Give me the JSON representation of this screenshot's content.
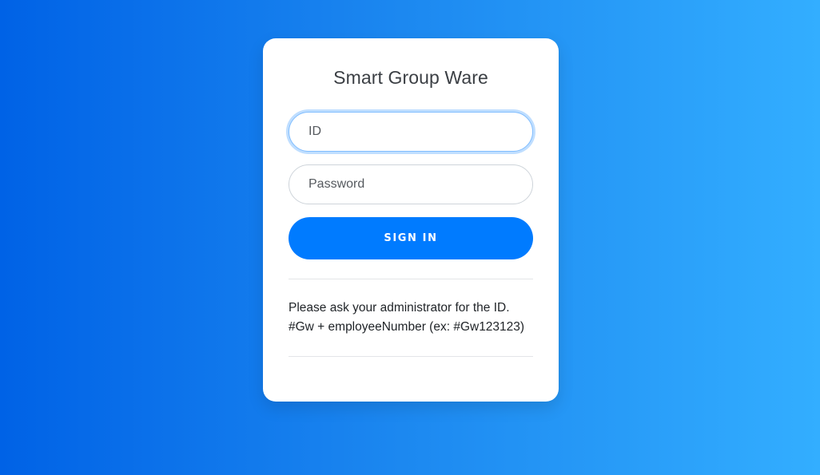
{
  "login": {
    "title": "Smart Group Ware",
    "id_field": {
      "placeholder": "ID",
      "value": ""
    },
    "password_field": {
      "placeholder": "Password",
      "value": ""
    },
    "signin_label": "SIGN IN",
    "help_lines": [
      "Please ask your administrator for the ID.",
      "#Gw + employeeNumber (ex: #Gw123123)"
    ]
  },
  "colors": {
    "background_gradient_start": "#0062e6",
    "background_gradient_end": "#33aeff",
    "card": "#ffffff",
    "button": "#007bff",
    "button_text": "#ffffff",
    "focus_ring": "#80bdff"
  }
}
